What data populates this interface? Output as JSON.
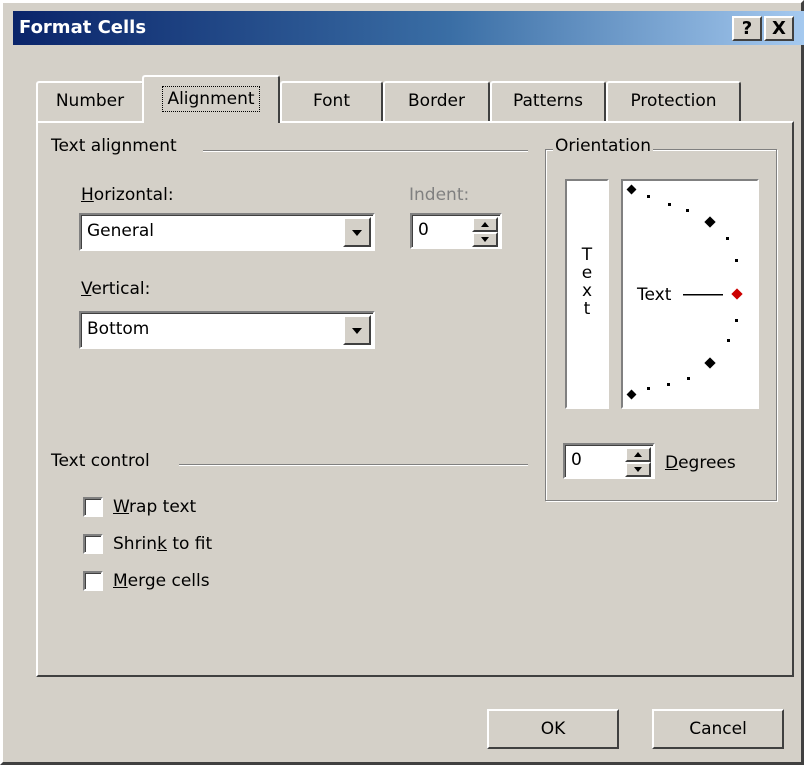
{
  "window": {
    "title": "Format Cells",
    "help_button": "?",
    "close_button": "X"
  },
  "tabs": [
    {
      "label": "Number",
      "active": false
    },
    {
      "label": "Alignment",
      "active": true
    },
    {
      "label": "Font",
      "active": false
    },
    {
      "label": "Border",
      "active": false
    },
    {
      "label": "Patterns",
      "active": false
    },
    {
      "label": "Protection",
      "active": false
    }
  ],
  "text_alignment": {
    "group_label": "Text alignment",
    "horizontal_label_prefix": "H",
    "horizontal_label_rest": "orizontal:",
    "horizontal_value": "General",
    "indent_label": "Indent:",
    "indent_value": "0",
    "vertical_label_prefix": "V",
    "vertical_label_rest": "ertical:",
    "vertical_value": "Bottom"
  },
  "text_control": {
    "group_label": "Text control",
    "options": [
      {
        "pre": "",
        "key": "W",
        "post": "rap text",
        "checked": false
      },
      {
        "pre": "Shrin",
        "key": "k",
        "post": " to fit",
        "checked": false
      },
      {
        "pre": "",
        "key": "M",
        "post": "erge cells",
        "checked": false
      }
    ]
  },
  "orientation": {
    "group_label": "Orientation",
    "vertical_text": [
      "T",
      "e",
      "x",
      "t"
    ],
    "dial_text": "Text",
    "degrees_value": "0",
    "degrees_label_prefix": "D",
    "degrees_label_rest": "egrees",
    "pointer_color": "#cc0000"
  },
  "buttons": {
    "ok": "OK",
    "cancel": "Cancel"
  },
  "colors": {
    "face": "#d4d0c8",
    "title_start": "#0a246a",
    "title_end": "#a6caf0",
    "disabled_text": "#808080"
  }
}
